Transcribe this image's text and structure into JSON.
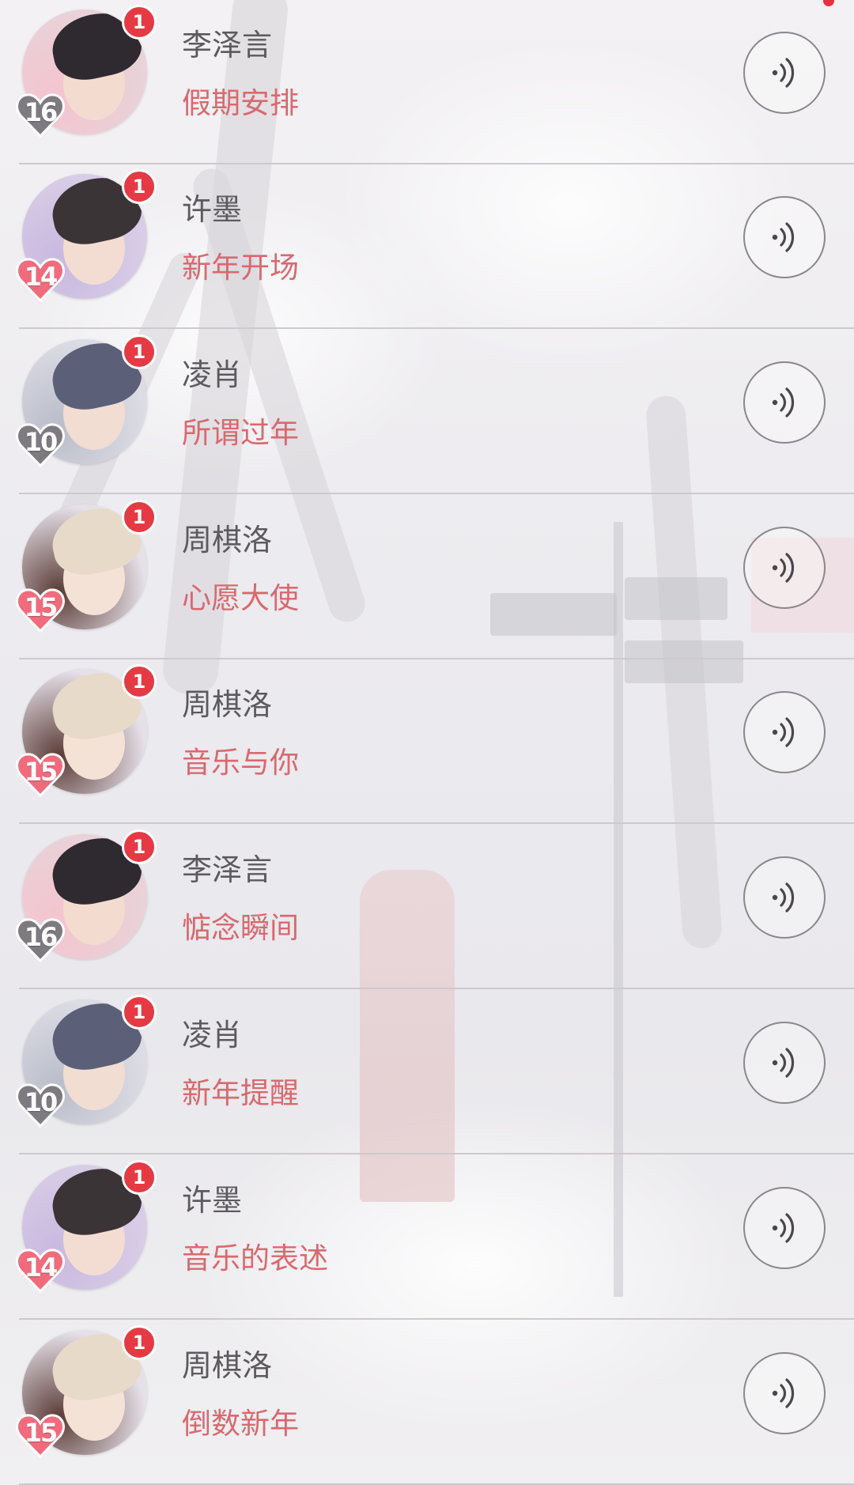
{
  "colors": {
    "badge": "#e53a43",
    "heart_red": "#f06b7c",
    "heart_gray": "#7d7a80",
    "name_text": "#5d5a5f",
    "title_text": "#d8696f",
    "divider": "#cdcacd"
  },
  "list": {
    "items": [
      {
        "name": "李泽言",
        "title": "假期安排",
        "unread": "1",
        "level": "16",
        "heart_style": "gray",
        "character": "lizeyan"
      },
      {
        "name": "许墨",
        "title": "新年开场",
        "unread": "1",
        "level": "14",
        "heart_style": "red",
        "character": "xumo"
      },
      {
        "name": "凌肖",
        "title": "所谓过年",
        "unread": "1",
        "level": "10",
        "heart_style": "gray",
        "character": "lingxiao"
      },
      {
        "name": "周棋洛",
        "title": "心愿大使",
        "unread": "1",
        "level": "15",
        "heart_style": "red",
        "character": "zhouqiluo"
      },
      {
        "name": "周棋洛",
        "title": "音乐与你",
        "unread": "1",
        "level": "15",
        "heart_style": "red",
        "character": "zhouqiluo"
      },
      {
        "name": "李泽言",
        "title": "惦念瞬间",
        "unread": "1",
        "level": "16",
        "heart_style": "gray",
        "character": "lizeyan"
      },
      {
        "name": "凌肖",
        "title": "新年提醒",
        "unread": "1",
        "level": "10",
        "heart_style": "gray",
        "character": "lingxiao"
      },
      {
        "name": "许墨",
        "title": "音乐的表述",
        "unread": "1",
        "level": "14",
        "heart_style": "red",
        "character": "xumo"
      },
      {
        "name": "周棋洛",
        "title": "倒数新年",
        "unread": "1",
        "level": "15",
        "heart_style": "red",
        "character": "zhouqiluo"
      }
    ]
  },
  "icons": {
    "play": "voice-play-icon",
    "level": "heart-level-icon"
  }
}
